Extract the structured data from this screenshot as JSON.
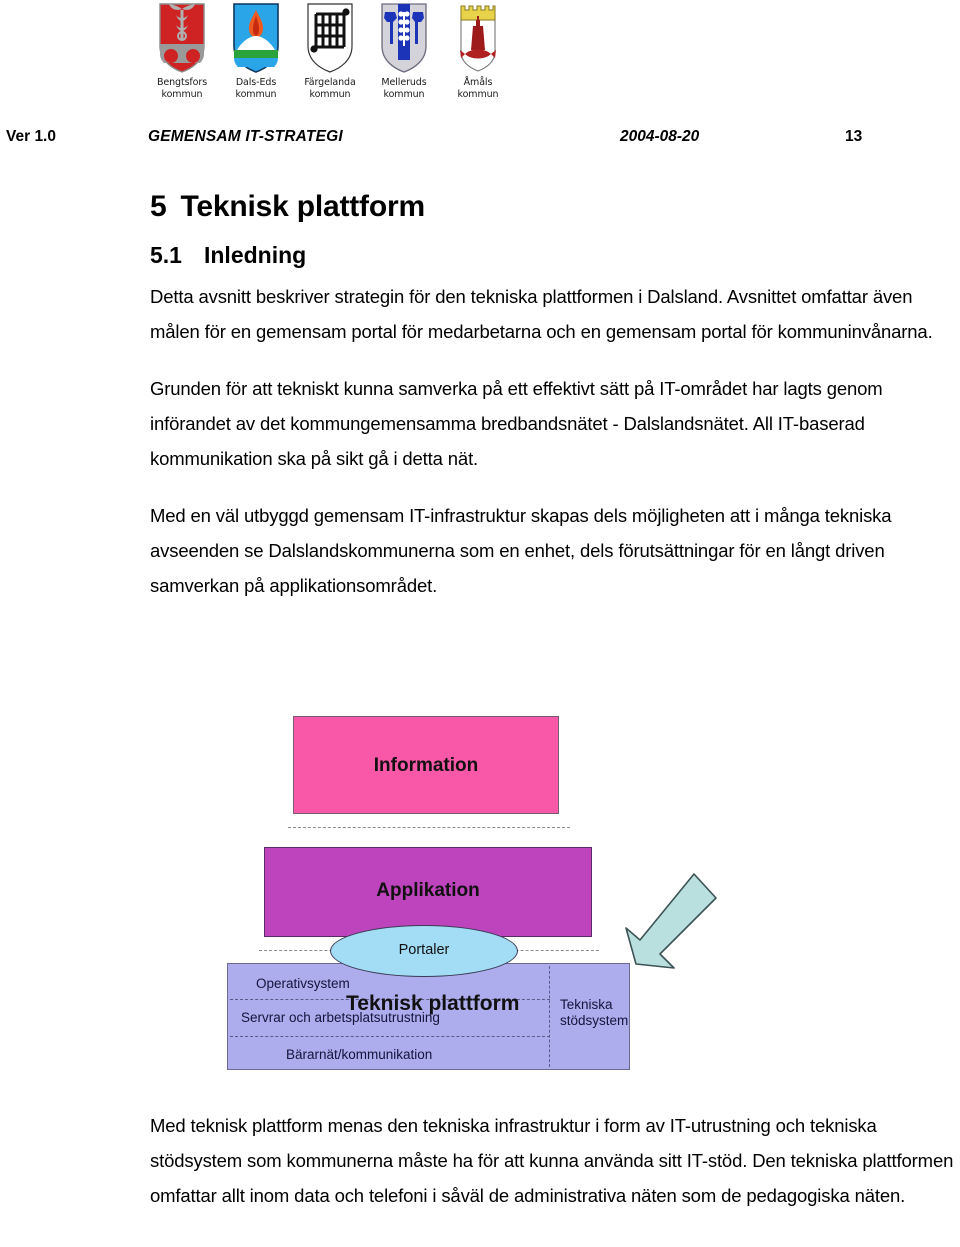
{
  "crests": [
    {
      "name": "bengtsfors",
      "label_line1": "Bengtsfors",
      "label_line2": "kommun"
    },
    {
      "name": "dals-ed",
      "label_line1": "Dals-Eds",
      "label_line2": "kommun"
    },
    {
      "name": "fargelanda",
      "label_line1": "Färgelanda",
      "label_line2": "kommun"
    },
    {
      "name": "mellerud",
      "label_line1": "Melleruds",
      "label_line2": "kommun"
    },
    {
      "name": "amal",
      "label_line1": "Åmåls",
      "label_line2": "kommun"
    }
  ],
  "header": {
    "version": "Ver 1.0",
    "title": "GEMENSAM IT-STRATEGI",
    "date": "2004-08-20",
    "page": "13"
  },
  "section": {
    "number": "5",
    "title": "Teknisk plattform",
    "sub_number": "5.1",
    "sub_title": "Inledning"
  },
  "paragraphs": {
    "p1": "Detta avsnitt beskriver strategin för den tekniska plattformen i Dalsland. Avsnittet omfattar även målen för en gemensam portal för medarbetarna och en gemensam portal för kommuninvånarna.",
    "p2": "Grunden för att tekniskt kunna samverka på ett effektivt sätt på IT-området har lagts genom införandet av det kommungemensamma bredbandsnätet - Dalslandsnätet. All IT-baserad kommunikation ska på sikt gå i detta nät.",
    "p3": "Med en väl utbyggd gemensam IT-infrastruktur skapas dels möjligheten att i många tekniska avseenden se Dalslandskommunerna som en enhet, dels förutsättningar för en långt driven samverkan på applikationsområdet.",
    "p4": "Med teknisk plattform menas den tekniska infrastruktur i form av IT-utrustning och tekniska stödsystem som kommunerna måste ha för att kunna använda sitt IT-stöd. Den tekniska plattformen omfattar allt inom data och telefoni i såväl de administrativa näten som de pedagogiska näten."
  },
  "diagram": {
    "information_label": "Information",
    "applikation_label": "Applikation",
    "portaler_label": "Portaler",
    "platform_label": "Teknisk plattform",
    "platform_rows": [
      "Operativsystem",
      "Servrar och arbetsplatsutrustning",
      "Bärarnät/kommunikation"
    ],
    "side_label_line1": "Tekniska",
    "side_label_line2": "stödsystem",
    "colors": {
      "information": "#f957a8",
      "applikation": "#bd44bd",
      "portaler": "#a3dcf5",
      "platform": "#adaded",
      "arrow": "#b9e0de"
    }
  }
}
